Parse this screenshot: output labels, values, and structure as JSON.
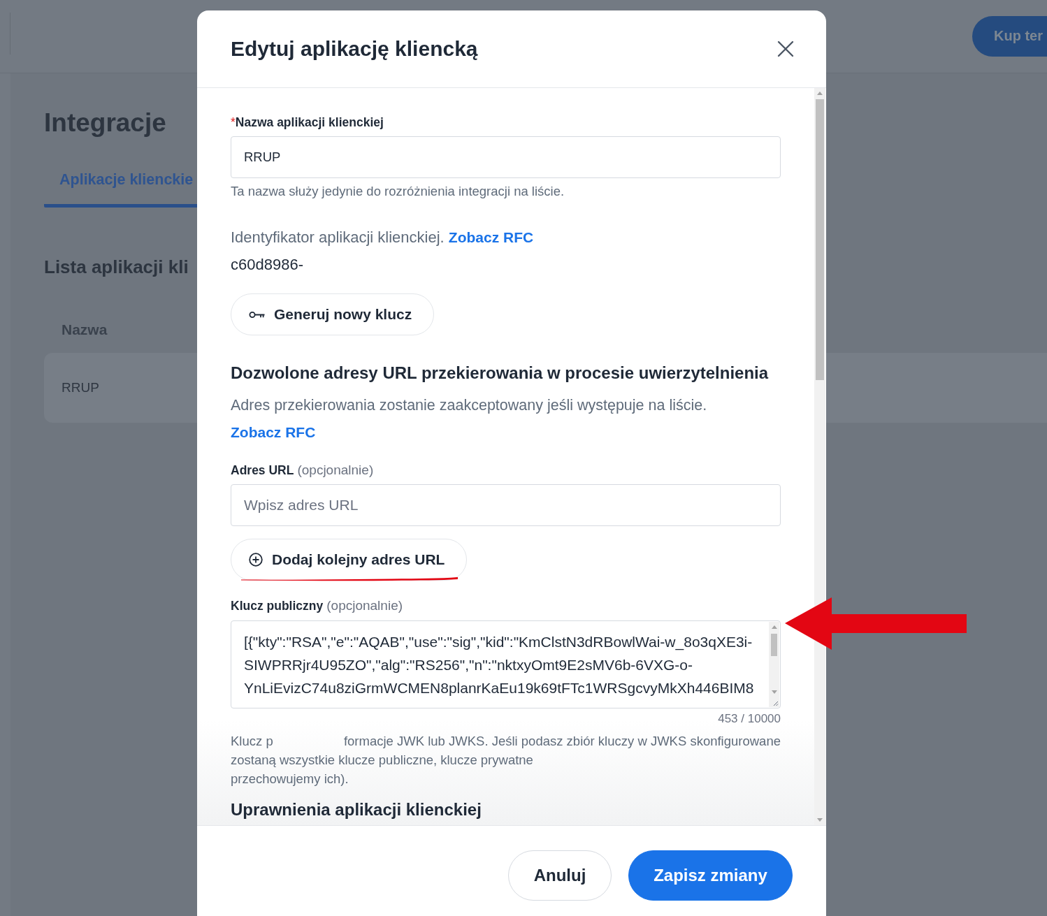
{
  "top_bar": {
    "buy_button": "Kup ter"
  },
  "page": {
    "title": "Integracje",
    "tabs": [
      {
        "label": "Aplikacje klienckie",
        "selected": true
      }
    ],
    "section_title": "Lista aplikacji kli",
    "table": {
      "columns": [
        "Nazwa"
      ],
      "rows": [
        [
          "RRUP"
        ]
      ]
    }
  },
  "dialog": {
    "title": "Edytuj aplikację kliencką",
    "name_field": {
      "required_mark": "*",
      "label": "Nazwa aplikacji klienckiej",
      "value": "RRUP",
      "hint": "Ta nazwa służy jedynie do rozróżnienia integracji na liście."
    },
    "client_id": {
      "label": "Identyfikator aplikacji klienckiej.",
      "link": "Zobacz RFC",
      "value": "c60d8986-"
    },
    "generate_button": "Generuj nowy klucz",
    "redirects": {
      "heading": "Dozwolone adresy URL przekierowania w procesie uwierzytelnienia",
      "description": "Adres przekierowania zostanie zaakceptowany jeśli występuje na liście.",
      "link": "Zobacz RFC",
      "url_field": {
        "label": "Adres URL",
        "optional_note": "(opcjonalnie)",
        "placeholder": "Wpisz adres URL"
      },
      "add_button": "Dodaj kolejny adres URL"
    },
    "public_key": {
      "label": "Klucz publiczny",
      "optional_note": "(opcjonalnie)",
      "value_lines": [
        "[{\"kty\":\"RSA\",\"e\":\"AQAB\",\"use\":\"sig\",\"kid\":\"KmClstN3dRBowlWai-w_8o3qXE3i-",
        "SIWPRRjr4U95ZO\",\"alg\":\"RS256\",\"n\":\"nktxyOmt9E2sMV6b-6VXG-o-",
        "YnLiEvizC74u8ziGrmWCMEN8planrKaEu19k69tFTc1WRSgcvyMkXh446BIM8"
      ],
      "counter": "453 / 10000",
      "help_lines": [
        [
          "Klucz p",
          "formacje JWK lub JWKS. Jeśli podasz zbiór kluczy w JWKS skonfigurowane"
        ],
        [
          "zostaną wszystkie klucze publiczne, klucze prywatne"
        ],
        [
          "przechowujemy ich)."
        ]
      ]
    },
    "next_heading": "Uprawnienia aplikacji klienckiej",
    "buttons": [
      {
        "label": "Anuluj",
        "kind": "secondary"
      },
      {
        "label": "Zapisz zmiany",
        "kind": "primary"
      }
    ]
  }
}
